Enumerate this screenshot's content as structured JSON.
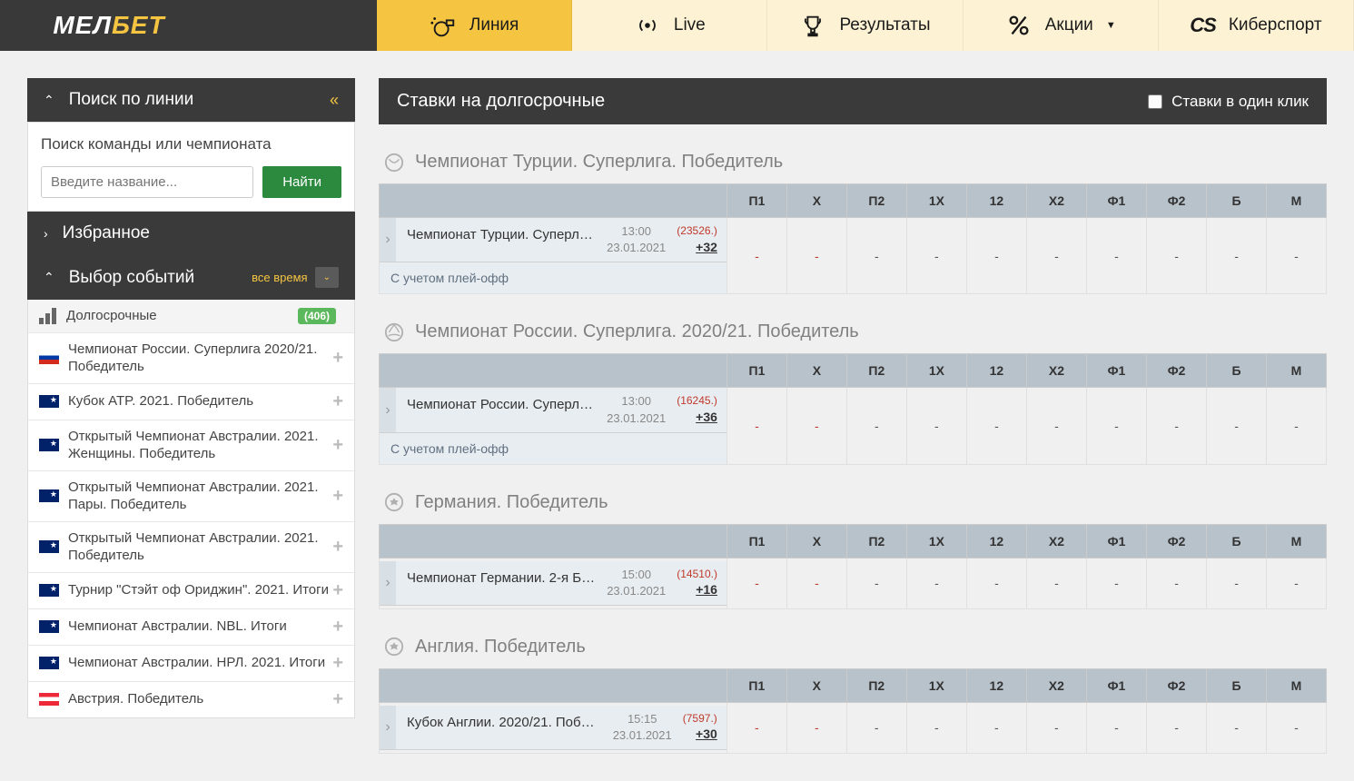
{
  "logo": {
    "part1": "МЕЛ",
    "part2": "БЕТ"
  },
  "nav": {
    "line": "Линия",
    "live": "Live",
    "results": "Результаты",
    "promo": "Акции",
    "esports": "Киберспорт"
  },
  "sidebar": {
    "search_header": "Поиск по линии",
    "search_title": "Поиск команды или чемпионата",
    "search_placeholder": "Введите название...",
    "search_btn": "Найти",
    "favorites": "Избранное",
    "events_header": "Выбор событий",
    "events_filter": "все время",
    "long_term": "Долгосрочные",
    "long_term_count": "(406)",
    "items": [
      "Чемпионат России. Суперлига 2020/21. Победитель",
      "Кубок ATP. 2021. Победитель",
      "Открытый Чемпионат Австралии. 2021. Женщины. Победитель",
      "Открытый Чемпионат Австралии. 2021. Пары. Победитель",
      "Открытый Чемпионат Австралии. 2021. Победитель",
      "Турнир \"Стэйт оф Ориджин\". 2021. Итоги",
      "Чемпионат Австралии. NBL. Итоги",
      "Чемпионат Австралии. НРЛ. 2021. Итоги",
      "Австрия. Победитель"
    ]
  },
  "main": {
    "title": "Ставки на долгосрочные",
    "one_click": "Ставки в один клик",
    "columns": [
      "П1",
      "X",
      "П2",
      "1X",
      "12",
      "X2",
      "Ф1",
      "Ф2",
      "Б",
      "М"
    ],
    "groups": [
      {
        "title": "Чемпионат Турции. Суперлига. Победитель",
        "event": "Чемпионат Турции. Суперл…",
        "time": "13:00",
        "date": "23.01.2021",
        "red": "(23526.)",
        "more": "+32",
        "note": "С учетом плей-офф"
      },
      {
        "title": "Чемпионат России. Суперлига. 2020/21. Победитель",
        "event": "Чемпионат России. Суперл…",
        "time": "13:00",
        "date": "23.01.2021",
        "red": "(16245.)",
        "more": "+36",
        "note": "С учетом плей-офф"
      },
      {
        "title": "Германия. Победитель",
        "event": "Чемпионат Германии. 2-я Б…",
        "time": "15:00",
        "date": "23.01.2021",
        "red": "(14510.)",
        "more": "+16",
        "note": ""
      },
      {
        "title": "Англия. Победитель",
        "event": "Кубок Англии. 2020/21. Поб…",
        "time": "15:15",
        "date": "23.01.2021",
        "red": "(7597.)",
        "more": "+30",
        "note": ""
      }
    ]
  }
}
